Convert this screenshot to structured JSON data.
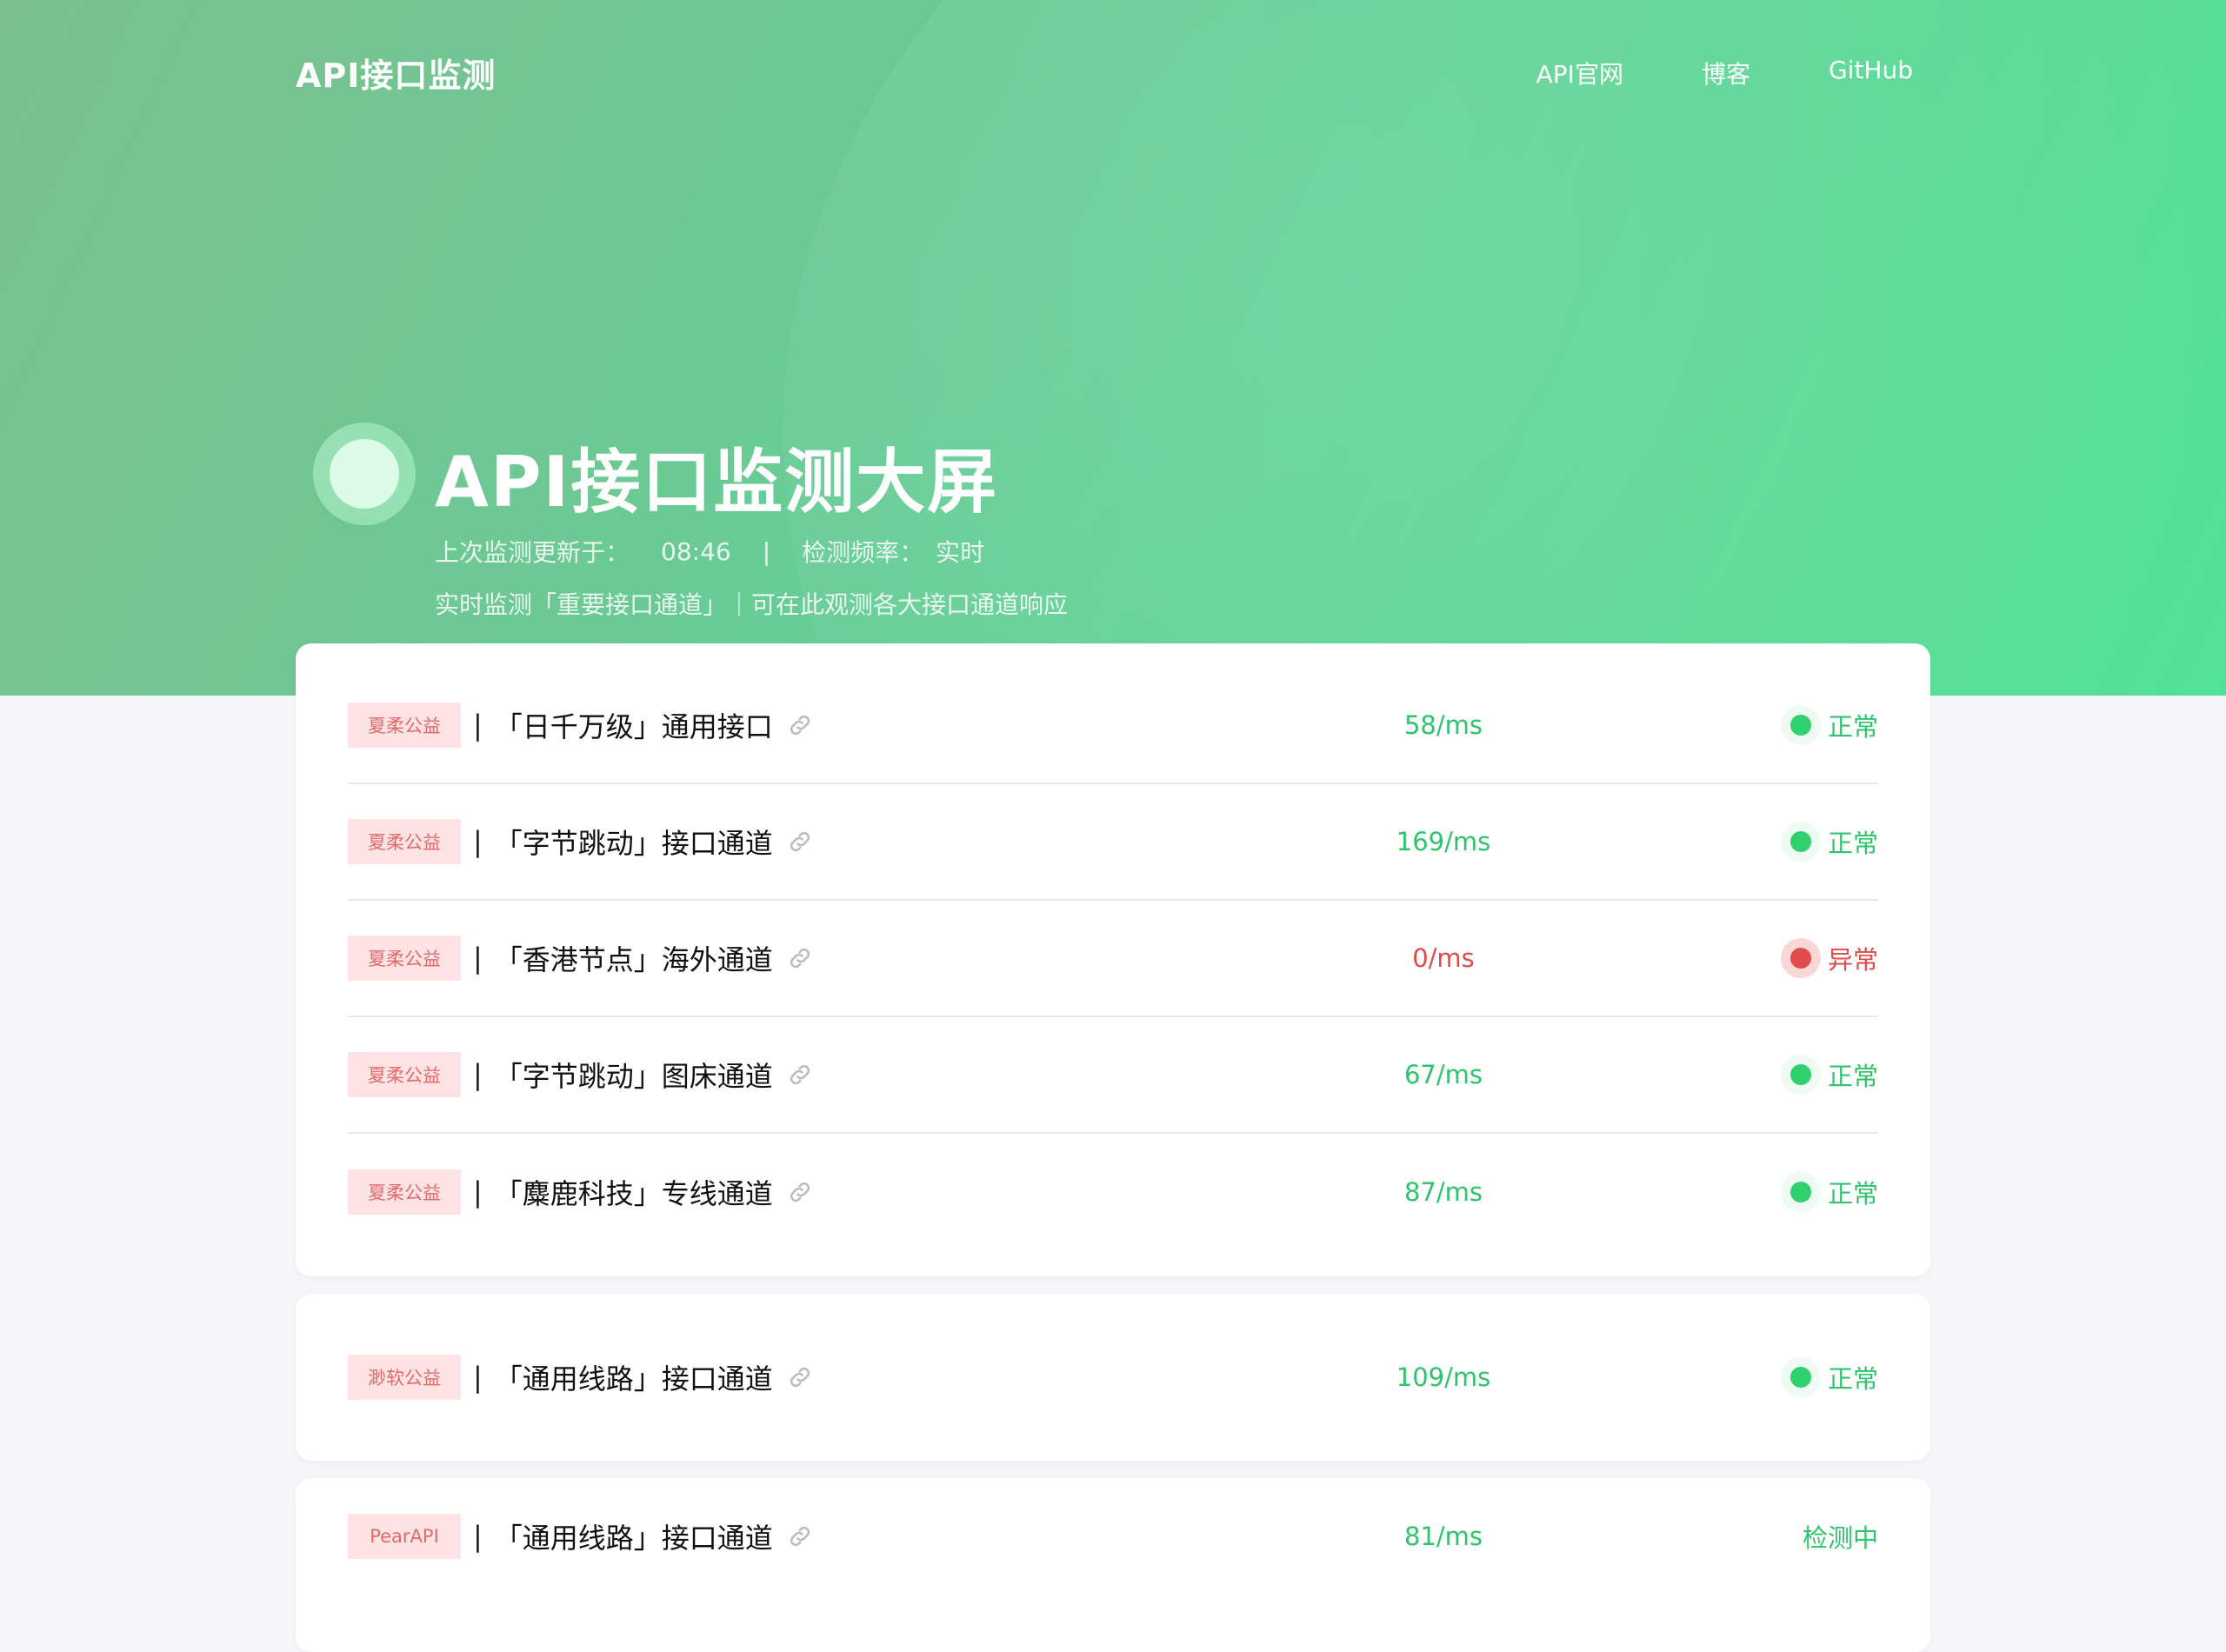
{
  "nav": {
    "brand": "API接口监测",
    "links": [
      "API官网",
      "博客",
      "GitHub"
    ]
  },
  "hero": {
    "title": "API接口监测大屏",
    "last_update_label": "上次监测更新于：",
    "last_update_time": "08:46",
    "separator": "|",
    "frequency_label": "检测频率：",
    "frequency_value": "实时",
    "description": "实时监测「重要接口通道」｜可在此观测各大接口通道响应"
  },
  "cards": [
    {
      "rows": [
        {
          "tag": "夏柔公益",
          "name": "「日千万级」通用接口",
          "latency": "58/ms",
          "status": "正常",
          "state": "ok"
        },
        {
          "tag": "夏柔公益",
          "name": "「字节跳动」接口通道",
          "latency": "169/ms",
          "status": "正常",
          "state": "ok"
        },
        {
          "tag": "夏柔公益",
          "name": "「香港节点」海外通道",
          "latency": "0/ms",
          "status": "异常",
          "state": "bad"
        },
        {
          "tag": "夏柔公益",
          "name": "「字节跳动」图床通道",
          "latency": "67/ms",
          "status": "正常",
          "state": "ok"
        },
        {
          "tag": "夏柔公益",
          "name": "「麋鹿科技」专线通道",
          "latency": "87/ms",
          "status": "正常",
          "state": "ok"
        }
      ]
    },
    {
      "rows": [
        {
          "tag": "渺软公益",
          "name": "「通用线路」接口通道",
          "latency": "109/ms",
          "status": "正常",
          "state": "ok"
        }
      ]
    },
    {
      "rows": [
        {
          "tag": "PearAPI",
          "name": "「通用线路」接口通道",
          "latency": "81/ms",
          "status": "检测中",
          "state": "ok"
        }
      ]
    }
  ],
  "row_separator": "|",
  "colors": {
    "ok": "#2fc46c",
    "bad": "#e14b4b",
    "tag_bg": "#fde3e3",
    "tag_text": "#e26a6a"
  },
  "icons": {
    "link": "link-icon",
    "status": "status-dot-icon"
  }
}
